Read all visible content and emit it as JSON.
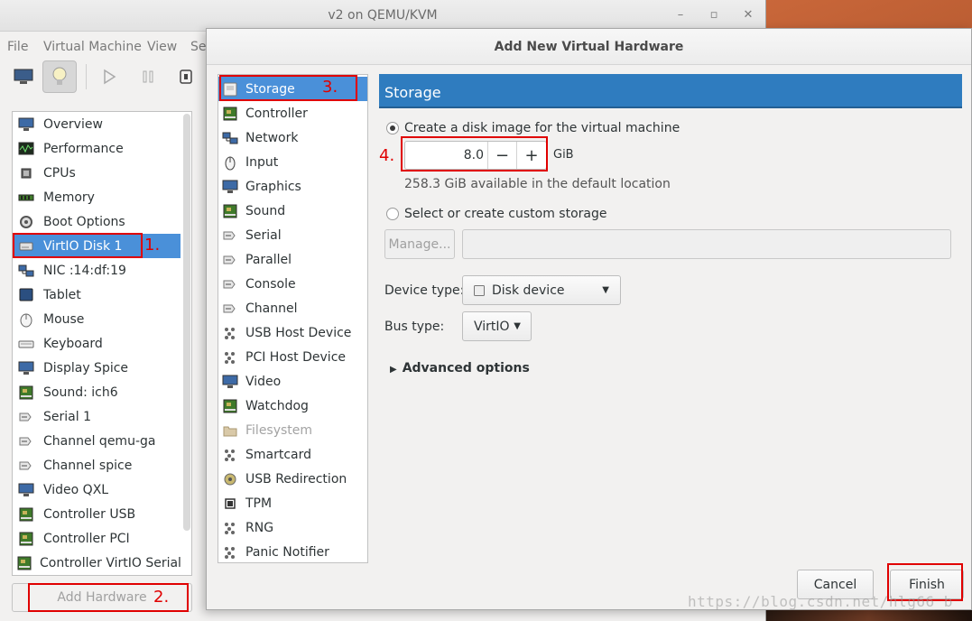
{
  "main_window": {
    "title": "v2 on QEMU/KVM",
    "menu": [
      "File",
      "Virtual Machine",
      "View",
      "Se"
    ],
    "devices": [
      {
        "label": "Overview",
        "icon": "overview-icon"
      },
      {
        "label": "Performance",
        "icon": "performance-icon"
      },
      {
        "label": "CPUs",
        "icon": "cpu-icon"
      },
      {
        "label": "Memory",
        "icon": "memory-icon"
      },
      {
        "label": "Boot Options",
        "icon": "boot-options-icon"
      },
      {
        "label": "VirtIO Disk 1",
        "icon": "disk-icon",
        "selected": true
      },
      {
        "label": "NIC :14:df:19",
        "icon": "nic-icon"
      },
      {
        "label": "Tablet",
        "icon": "tablet-icon"
      },
      {
        "label": "Mouse",
        "icon": "mouse-icon"
      },
      {
        "label": "Keyboard",
        "icon": "keyboard-icon"
      },
      {
        "label": "Display Spice",
        "icon": "display-icon"
      },
      {
        "label": "Sound: ich6",
        "icon": "sound-icon"
      },
      {
        "label": "Serial 1",
        "icon": "serial-icon"
      },
      {
        "label": "Channel qemu-ga",
        "icon": "channel-icon"
      },
      {
        "label": "Channel spice",
        "icon": "channel-icon"
      },
      {
        "label": "Video QXL",
        "icon": "video-icon"
      },
      {
        "label": "Controller USB",
        "icon": "controller-icon"
      },
      {
        "label": "Controller PCI",
        "icon": "controller-icon"
      },
      {
        "label": "Controller VirtIO Serial",
        "icon": "controller-icon"
      }
    ],
    "add_hardware_label": "Add Hardware"
  },
  "dialog": {
    "title": "Add New Virtual Hardware",
    "hardware_types": [
      {
        "label": "Storage",
        "icon": "storage-icon",
        "selected": true
      },
      {
        "label": "Controller",
        "icon": "controller-icon"
      },
      {
        "label": "Network",
        "icon": "network-icon"
      },
      {
        "label": "Input",
        "icon": "input-icon"
      },
      {
        "label": "Graphics",
        "icon": "graphics-icon"
      },
      {
        "label": "Sound",
        "icon": "sound-icon"
      },
      {
        "label": "Serial",
        "icon": "serial-icon"
      },
      {
        "label": "Parallel",
        "icon": "parallel-icon"
      },
      {
        "label": "Console",
        "icon": "console-icon"
      },
      {
        "label": "Channel",
        "icon": "channel-icon"
      },
      {
        "label": "USB Host Device",
        "icon": "usb-icon"
      },
      {
        "label": "PCI Host Device",
        "icon": "pci-icon"
      },
      {
        "label": "Video",
        "icon": "video-icon"
      },
      {
        "label": "Watchdog",
        "icon": "watchdog-icon"
      },
      {
        "label": "Filesystem",
        "icon": "folder-icon",
        "disabled": true
      },
      {
        "label": "Smartcard",
        "icon": "smartcard-icon"
      },
      {
        "label": "USB Redirection",
        "icon": "usb-redirection-icon"
      },
      {
        "label": "TPM",
        "icon": "tpm-icon"
      },
      {
        "label": "RNG",
        "icon": "rng-icon"
      },
      {
        "label": "Panic Notifier",
        "icon": "panic-icon"
      }
    ],
    "storage": {
      "header": "Storage",
      "option_create_label": "Create a disk image for the virtual machine",
      "size_value": "8.0",
      "size_unit": "GiB",
      "available_text": "258.3 GiB available in the default location",
      "option_custom_label": "Select or create custom storage",
      "manage_label": "Manage...",
      "device_type_label": "Device type:",
      "device_type_value": "Disk device",
      "bus_type_label": "Bus type:",
      "bus_type_value": "VirtIO",
      "advanced_label": "Advanced options"
    },
    "cancel_label": "Cancel",
    "finish_label": "Finish"
  },
  "annotations": {
    "n1": "1.",
    "n2": "2.",
    "n3": "3.",
    "n4": "4.",
    "color": "#e00000"
  },
  "watermark": "https://blog.csdn.net/hlg66_b"
}
